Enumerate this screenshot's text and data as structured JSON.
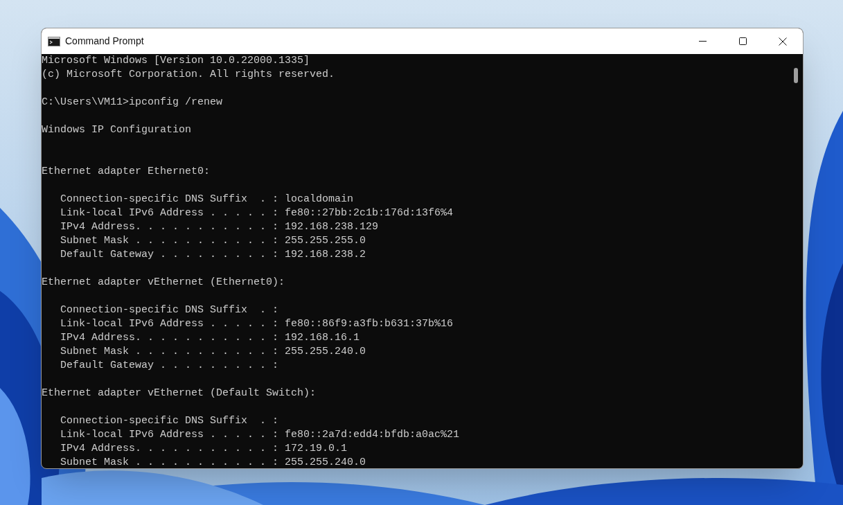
{
  "window": {
    "title": "Command Prompt",
    "controls": [
      {
        "kind": "minimize"
      },
      {
        "kind": "maximize"
      },
      {
        "kind": "close"
      }
    ]
  },
  "console": {
    "lines": [
      {
        "kind": "text",
        "text": "Microsoft Windows [Version 10.0.22000.1335]"
      },
      {
        "kind": "text",
        "text": "(c) Microsoft Corporation. All rights reserved."
      },
      {
        "kind": "blank"
      },
      {
        "kind": "text",
        "text": "C:\\Users\\VM11>ipconfig /renew"
      },
      {
        "kind": "blank"
      },
      {
        "kind": "text",
        "text": "Windows IP Configuration"
      },
      {
        "kind": "blank"
      },
      {
        "kind": "blank"
      },
      {
        "kind": "text",
        "text": "Ethernet adapter Ethernet0:"
      },
      {
        "kind": "blank"
      },
      {
        "kind": "text",
        "text": "   Connection-specific DNS Suffix  . : localdomain"
      },
      {
        "kind": "text",
        "text": "   Link-local IPv6 Address . . . . . : fe80::27bb:2c1b:176d:13f6%4"
      },
      {
        "kind": "text",
        "text": "   IPv4 Address. . . . . . . . . . . : 192.168.238.129"
      },
      {
        "kind": "text",
        "text": "   Subnet Mask . . . . . . . . . . . : 255.255.255.0"
      },
      {
        "kind": "text",
        "text": "   Default Gateway . . . . . . . . . : 192.168.238.2"
      },
      {
        "kind": "blank"
      },
      {
        "kind": "text",
        "text": "Ethernet adapter vEthernet (Ethernet0):"
      },
      {
        "kind": "blank"
      },
      {
        "kind": "text",
        "text": "   Connection-specific DNS Suffix  . :"
      },
      {
        "kind": "text",
        "text": "   Link-local IPv6 Address . . . . . : fe80::86f9:a3fb:b631:37b%16"
      },
      {
        "kind": "text",
        "text": "   IPv4 Address. . . . . . . . . . . : 192.168.16.1"
      },
      {
        "kind": "text",
        "text": "   Subnet Mask . . . . . . . . . . . : 255.255.240.0"
      },
      {
        "kind": "text",
        "text": "   Default Gateway . . . . . . . . . :"
      },
      {
        "kind": "blank"
      },
      {
        "kind": "text",
        "text": "Ethernet adapter vEthernet (Default Switch):"
      },
      {
        "kind": "blank"
      },
      {
        "kind": "text",
        "text": "   Connection-specific DNS Suffix  . :"
      },
      {
        "kind": "text",
        "text": "   Link-local IPv6 Address . . . . . : fe80::2a7d:edd4:bfdb:a0ac%21"
      },
      {
        "kind": "text",
        "text": "   IPv4 Address. . . . . . . . . . . : 172.19.0.1"
      },
      {
        "kind": "text",
        "text": "   Subnet Mask . . . . . . . . . . . : 255.255.240.0"
      }
    ]
  }
}
